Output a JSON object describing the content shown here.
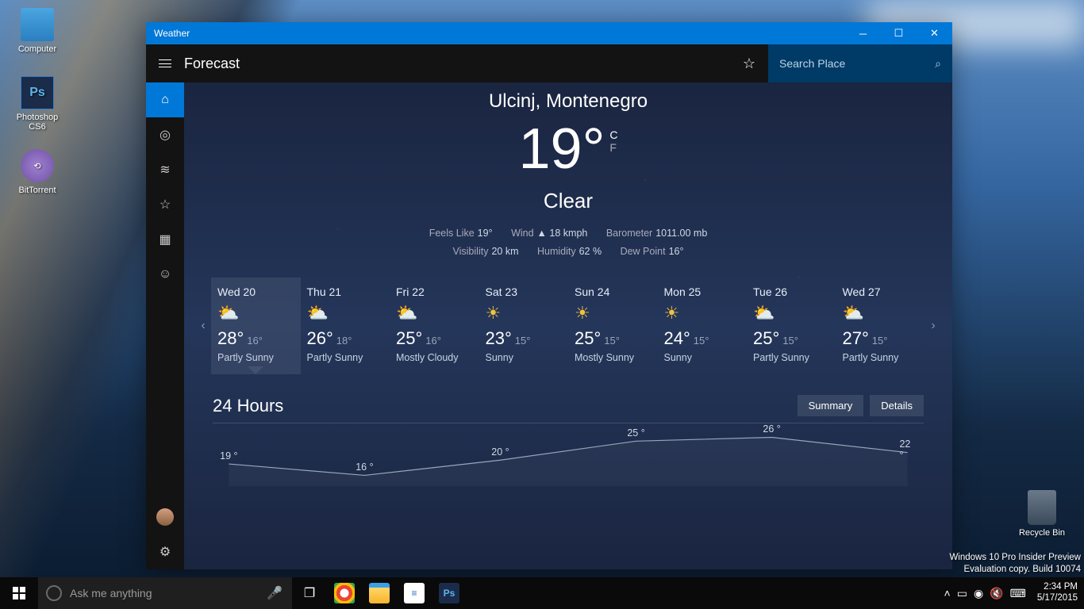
{
  "desktop": {
    "icons": [
      {
        "label": "Computer"
      },
      {
        "label": "Photoshop CS6"
      },
      {
        "label": "BitTorrent"
      },
      {
        "label": "Recycle Bin"
      }
    ]
  },
  "window": {
    "title": "Weather"
  },
  "header": {
    "title": "Forecast",
    "search_placeholder": "Search Place"
  },
  "current": {
    "location": "Ulcinj, Montenegro",
    "temp": "19°",
    "unit_c": "C",
    "unit_f": "F",
    "condition": "Clear",
    "feels_like_lbl": "Feels Like",
    "feels_like": "19°",
    "wind_lbl": "Wind",
    "wind": "18 kmph",
    "barometer_lbl": "Barometer",
    "barometer": "1011.00 mb",
    "visibility_lbl": "Visibility",
    "visibility": "20 km",
    "humidity_lbl": "Humidity",
    "humidity": "62 %",
    "dewpoint_lbl": "Dew Point",
    "dewpoint": "16°"
  },
  "forecast": [
    {
      "day": "Wed 20",
      "hi": "28°",
      "lo": "16°",
      "desc": "Partly Sunny",
      "icon": "partly"
    },
    {
      "day": "Thu 21",
      "hi": "26°",
      "lo": "18°",
      "desc": "Partly Sunny",
      "icon": "partly"
    },
    {
      "day": "Fri 22",
      "hi": "25°",
      "lo": "16°",
      "desc": "Mostly Cloudy",
      "icon": "partly"
    },
    {
      "day": "Sat 23",
      "hi": "23°",
      "lo": "15°",
      "desc": "Sunny",
      "icon": "sunny"
    },
    {
      "day": "Sun 24",
      "hi": "25°",
      "lo": "15°",
      "desc": "Mostly Sunny",
      "icon": "sunny"
    },
    {
      "day": "Mon 25",
      "hi": "24°",
      "lo": "15°",
      "desc": "Sunny",
      "icon": "sunny"
    },
    {
      "day": "Tue 26",
      "hi": "25°",
      "lo": "15°",
      "desc": "Partly Sunny",
      "icon": "partly"
    },
    {
      "day": "Wed 27",
      "hi": "27°",
      "lo": "15°",
      "desc": "Partly Sunny",
      "icon": "partly"
    }
  ],
  "hourly": {
    "label": "24 Hours",
    "summary": "Summary",
    "details": "Details"
  },
  "chart_data": {
    "type": "line",
    "title": "24 Hours",
    "ylabel": "°",
    "ylim": [
      14,
      28
    ],
    "x": [
      0,
      1,
      2,
      3,
      4,
      5
    ],
    "values": [
      19,
      16,
      20,
      25,
      26,
      22
    ],
    "labels": [
      "19 °",
      "16 °",
      "20 °",
      "25 °",
      "26 °",
      "22 °"
    ]
  },
  "watermark": {
    "line1": "Windows 10 Pro Insider Preview",
    "line2": "Evaluation copy. Build 10074"
  },
  "taskbar": {
    "cortana": "Ask me anything",
    "time": "2:34 PM",
    "date": "5/17/2015"
  }
}
